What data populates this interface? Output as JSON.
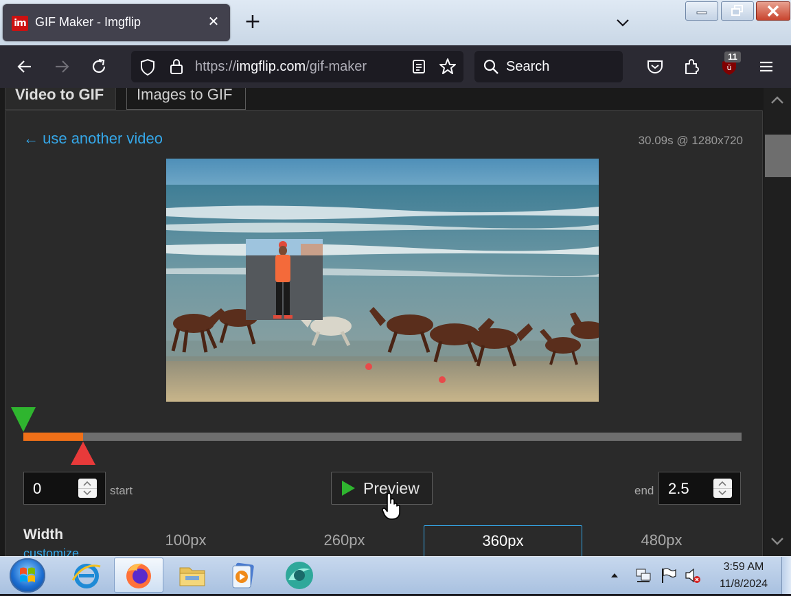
{
  "browser": {
    "tab_title": "GIF Maker - Imgflip",
    "favicon_text": "im",
    "url_scheme": "https://",
    "url_host": "imgflip.com",
    "url_path": "/gif-maker",
    "search_placeholder": "Search",
    "extension_badge": "11"
  },
  "page": {
    "mode_tabs": [
      {
        "label": "Video to GIF",
        "active": true
      },
      {
        "label": "Images to GIF",
        "active": false
      }
    ],
    "back_link": "← use another video",
    "video_info": "30.09s @ 1280x720",
    "timeline": {
      "start_fraction": 0.0,
      "end_fraction": 0.083,
      "accent_color": "#f07018"
    },
    "start_value": "0",
    "start_label": "start",
    "end_label": "end",
    "end_value": "2.5",
    "preview_label": "Preview",
    "width_label": "Width",
    "customize_label": "customize",
    "width_options": [
      {
        "label": "100px",
        "selected": false
      },
      {
        "label": "260px",
        "selected": false
      },
      {
        "label": "360px",
        "selected": true
      },
      {
        "label": "480px",
        "selected": false
      }
    ]
  },
  "taskbar": {
    "apps": [
      "internet-explorer-icon",
      "firefox-icon",
      "file-explorer-icon",
      "media-player-icon",
      "app-icon"
    ],
    "clock_time": "3:59 AM",
    "clock_date": "11/8/2024"
  }
}
